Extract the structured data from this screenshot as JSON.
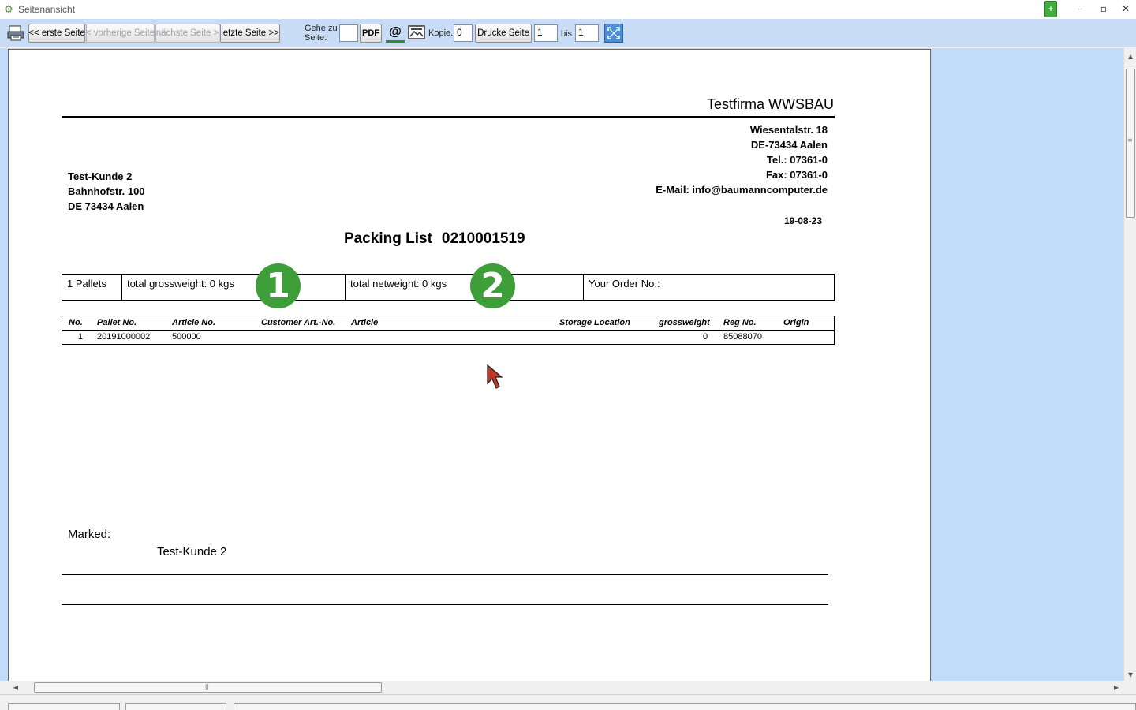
{
  "window": {
    "title": "Seitenansicht",
    "app_icon": "gear-icon",
    "controls": {
      "minimize": "–",
      "maximize": "▫",
      "close": "✕"
    }
  },
  "toolbar": {
    "print_icon": "printer-icon",
    "first_page": "<< erste Seite",
    "prev_page": "< vorherige Seite",
    "next_page": "nächste Seite >",
    "last_page": "letzte Seite >>",
    "goto_label_line1": "Gehe zu",
    "goto_label_line2": "Seite:",
    "goto_value": "",
    "pdf_label": "PDF",
    "email_icon": "at-sign-icon",
    "image_icon": "picture-icon",
    "copies_label": "Kopie.:",
    "copies_value": "0",
    "print_page_label": "Drucke Seite",
    "from_page_value": "1",
    "to_label": "bis",
    "to_page_value": "1",
    "fullscreen_icon": "fullscreen-icon"
  },
  "document": {
    "company": "Testfirma WWSBAU",
    "sender_address": [
      "Wiesentalstr. 18",
      "DE-73434 Aalen",
      "Tel.: 07361-0",
      "Fax: 07361-0",
      "E-Mail: info@baumanncomputer.de"
    ],
    "recipient_address": [
      "Test-Kunde 2",
      "Bahnhofstr. 100",
      "DE 73434 Aalen"
    ],
    "date": "19-08-23",
    "title": "Packing List",
    "number": "0210001519",
    "summary": {
      "pallets": "1 Pallets",
      "grossweight": "total grossweight: 0 kgs",
      "netweight": "total netweight: 0 kgs",
      "order_no": "Your Order No.:"
    },
    "badges": [
      "1",
      "2"
    ],
    "table": {
      "headers": {
        "no": "No.",
        "pallet_no": "Pallet No.",
        "article_no": "Article No.",
        "customer_art_no": "Customer Art.-No.",
        "article": "Article",
        "storage_location": "Storage Location",
        "grossweight": "grossweight",
        "reg_no": "Reg No.",
        "origin": "Origin"
      },
      "rows": [
        {
          "no": "1",
          "pallet_no": "20191000002",
          "article_no": "500000",
          "customer_art_no": "",
          "article": "",
          "storage_location": "",
          "grossweight": "0",
          "reg_no": "85088070",
          "origin": ""
        }
      ]
    },
    "marked_label": "Marked:",
    "marked_value": "Test-Kunde 2"
  },
  "colors": {
    "toolbar_bg": "#c9dcf5",
    "workarea_bg": "#c1dbfa",
    "badge_green": "#3e9e3a"
  }
}
